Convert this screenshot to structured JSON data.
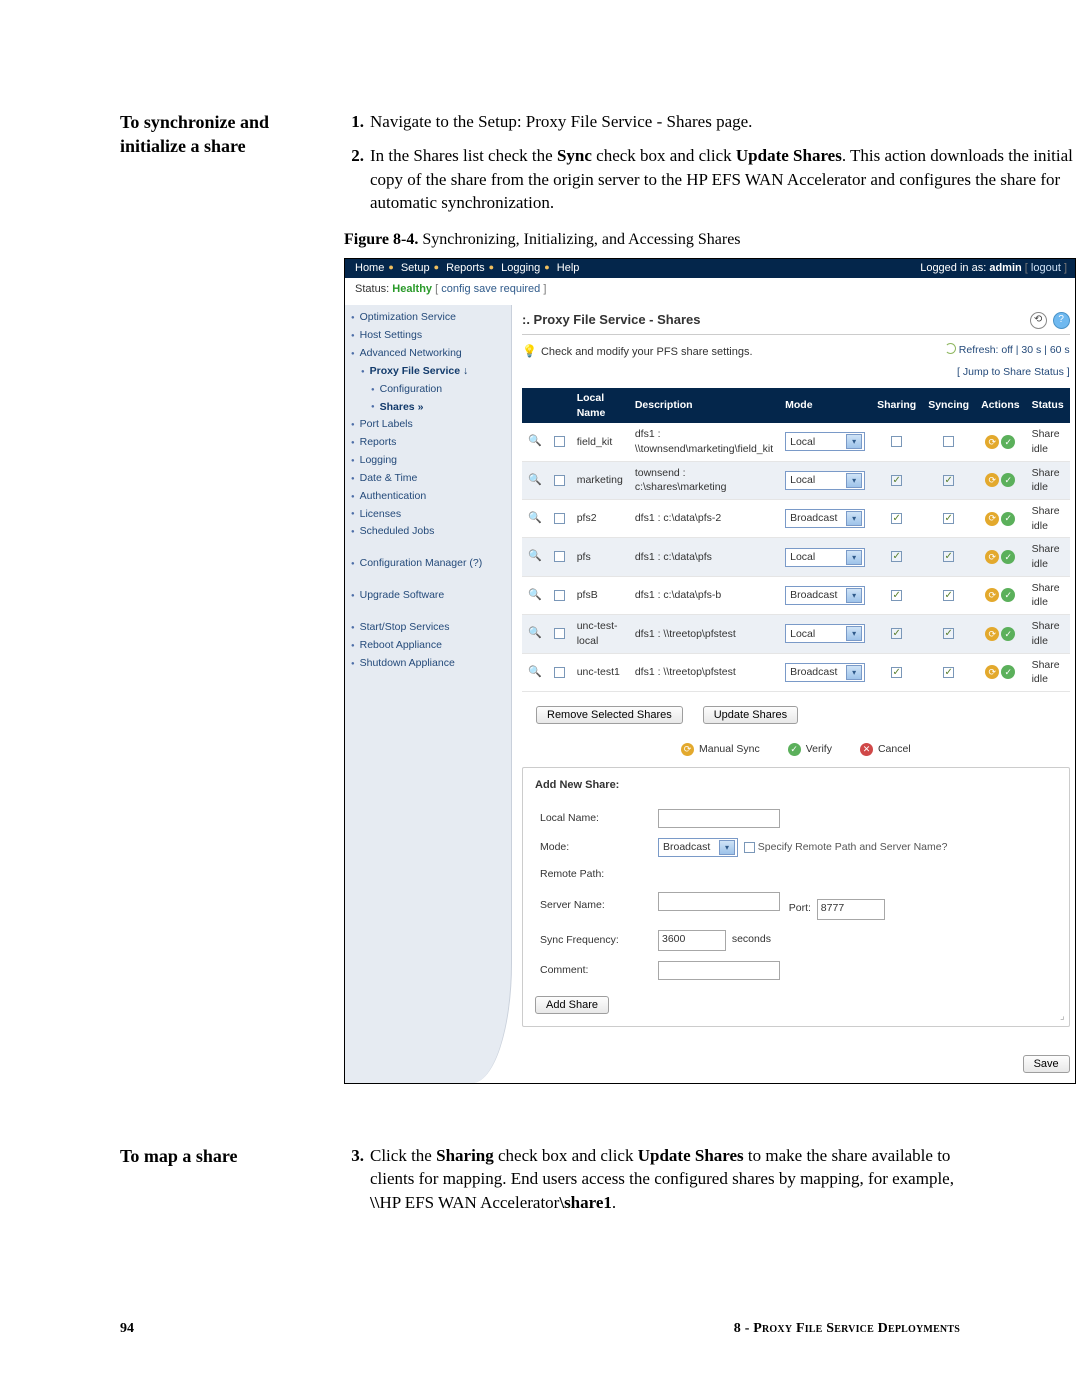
{
  "section1": {
    "heading": "To synchronize and initialize a share",
    "step1_num": "1.",
    "step1": "Navigate to the Setup: Proxy File Service - Shares page.",
    "step2_num": "2.",
    "step2_pre": "In the Shares list check the ",
    "step2_b1": "Sync",
    "step2_mid": " check box and click ",
    "step2_b2": "Update Shares",
    "step2_post": ". This action downloads the initial copy of the share from the origin server to the HP EFS WAN Accelerator and configures the share for automatic synchronization.",
    "fig_label": "Figure 8-4.",
    "fig_caption": " Synchronizing, Initializing, and Accessing Shares"
  },
  "ss": {
    "topnav": {
      "home": "Home",
      "setup": "Setup",
      "reports": "Reports",
      "logging": "Logging",
      "help": "Help"
    },
    "status_label": "Status: ",
    "status_val": "Healthy",
    "status_note": " config save required ",
    "logged_pre": "Logged in as: ",
    "logged_user": "admin",
    "logged_post": " logout ",
    "sidebar": {
      "opt": "Optimization Service",
      "host": "Host Settings",
      "adv": "Advanced Networking",
      "pfs": "Proxy File Service ↓",
      "conf": "Configuration",
      "shares": "Shares »",
      "port": "Port Labels",
      "reports": "Reports",
      "log": "Logging",
      "date": "Date & Time",
      "auth": "Authentication",
      "lic": "Licenses",
      "sched": "Scheduled Jobs",
      "cfgmgr": "Configuration Manager  (?)",
      "upg": "Upgrade Software",
      "start": "Start/Stop Services",
      "reboot": "Reboot Appliance",
      "shut": "Shutdown Appliance"
    },
    "ptitle": ":. Proxy File Service - Shares",
    "hint": "Check and modify your PFS share settings.",
    "refresh": "Refresh: off | 30 s | 60 s",
    "jump": "[ Jump to Share Status ]",
    "th": {
      "ln": "Local Name",
      "desc": "Description",
      "mode": "Mode",
      "sharing": "Sharing",
      "syncing": "Syncing",
      "actions": "Actions",
      "status": "Status"
    },
    "rows": [
      {
        "ln": "field_kit",
        "desc": "dfs1 : \\\\townsend\\marketing\\field_kit",
        "mode": "Local",
        "sh": false,
        "sy": false,
        "st": "Share idle"
      },
      {
        "ln": "marketing",
        "desc": "townsend : c:\\shares\\marketing",
        "mode": "Local",
        "sh": true,
        "sy": true,
        "st": "Share idle"
      },
      {
        "ln": "pfs2",
        "desc": "dfs1 : c:\\data\\pfs-2",
        "mode": "Broadcast",
        "sh": true,
        "sy": true,
        "st": "Share idle"
      },
      {
        "ln": "pfs",
        "desc": "dfs1 : c:\\data\\pfs",
        "mode": "Local",
        "sh": true,
        "sy": true,
        "st": "Share idle"
      },
      {
        "ln": "pfsB",
        "desc": "dfs1 : c:\\data\\pfs-b",
        "mode": "Broadcast",
        "sh": true,
        "sy": true,
        "st": "Share idle"
      },
      {
        "ln": "unc-test-local",
        "desc": "dfs1 : \\\\treetop\\pfstest",
        "mode": "Local",
        "sh": true,
        "sy": true,
        "st": "Share idle"
      },
      {
        "ln": "unc-test1",
        "desc": "dfs1 : \\\\treetop\\pfstest",
        "mode": "Broadcast",
        "sh": true,
        "sy": true,
        "st": "Share idle"
      }
    ],
    "btn_remove": "Remove Selected Shares",
    "btn_update": "Update Shares",
    "icon_ms": "Manual Sync",
    "icon_vf": "Verify",
    "icon_cn": "Cancel",
    "form": {
      "title": "Add New Share:",
      "ln": "Local Name:",
      "mode": "Mode:",
      "mode_val": "Broadcast",
      "spec": "Specify Remote Path and Server Name?",
      "rp": "Remote Path:",
      "sn": "Server Name:",
      "port": "Port:",
      "port_val": "8777",
      "sf": "Sync Frequency:",
      "sf_val": "3600",
      "sf_unit": "seconds",
      "cm": "Comment:",
      "add": "Add Share"
    },
    "save": "Save"
  },
  "section2": {
    "heading": "To map a share",
    "step3_num": "3.",
    "s3_pre": "Click the ",
    "s3_b1": "Sharing",
    "s3_mid": " check box and click ",
    "s3_b2": "Update Shares",
    "s3_mid2": " to make the share available to clients for mapping. End users access the configured shares by mapping, for example, ",
    "s3_b3": "\\\\",
    "s3_path": "HP EFS WAN Accelerator",
    "s3_b4": "\\share1",
    "s3_end": "."
  },
  "footer": {
    "page": "94",
    "chapter": "8 - Proxy File Service Deployments"
  }
}
